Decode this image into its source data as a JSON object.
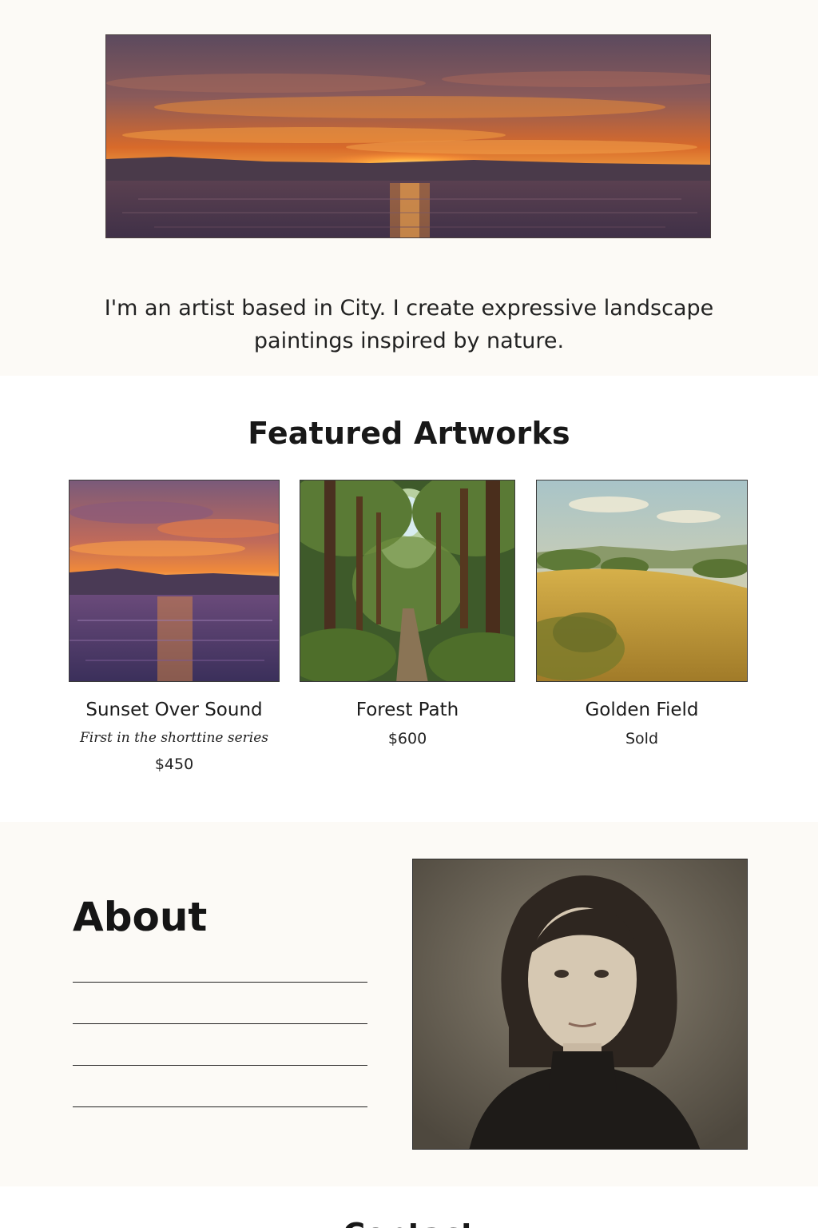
{
  "intro": {
    "text": "I'm an artist based in City. I create expressive landscape paintings inspired by nature."
  },
  "featured": {
    "title": "Featured Artworks",
    "artworks": [
      {
        "title": "Sunset Over Sound",
        "subtitle": "First in the shorttine series",
        "price": "$450"
      },
      {
        "title": "Forest Path",
        "subtitle": "",
        "price": "$600"
      },
      {
        "title": "Golden Field",
        "subtitle": "",
        "price": "Sold"
      }
    ]
  },
  "about": {
    "title": "About"
  },
  "contact": {
    "title": "Contact"
  },
  "colors": {
    "background": "#fcfaf6",
    "section_alt": "#ffffff",
    "text": "#1f1f1f"
  }
}
